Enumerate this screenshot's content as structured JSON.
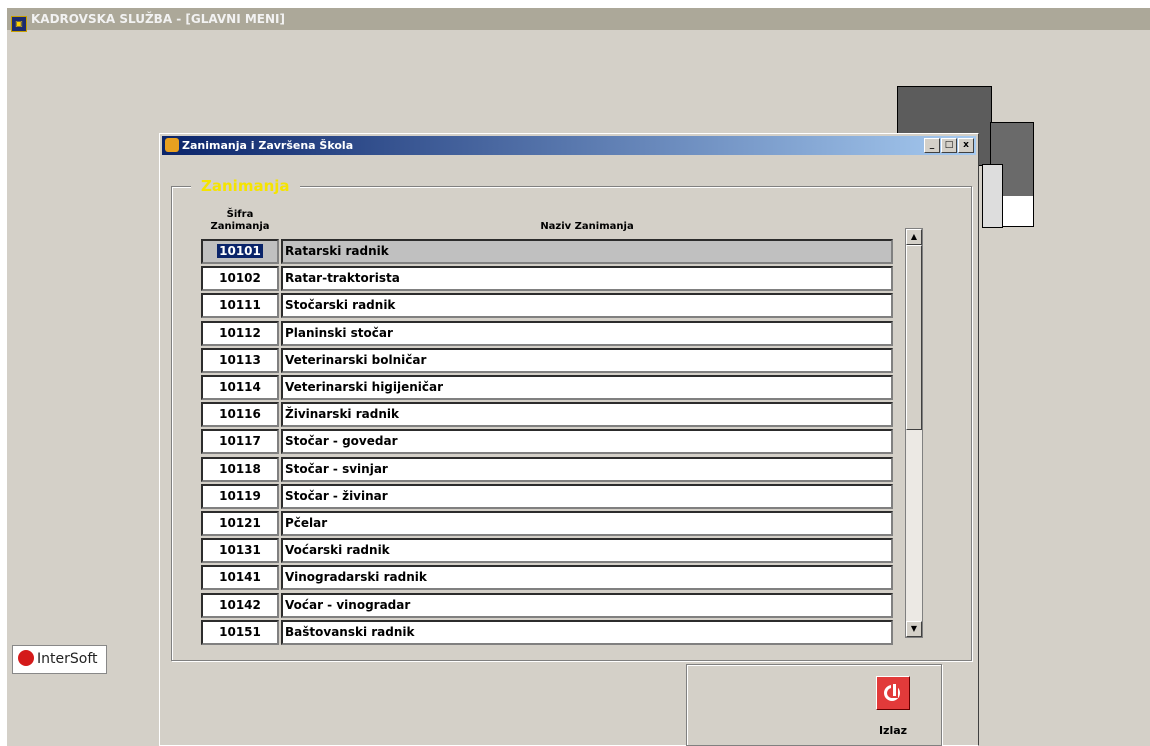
{
  "app": {
    "title": "KADROVSKA SLUŽBA - [GLAVNI MENI]"
  },
  "logo": {
    "text": "InterSoft"
  },
  "dialog": {
    "title": "Zanimanja i Završena Škola",
    "window_buttons": {
      "minimize": "_",
      "maximize": "□",
      "close": "x"
    },
    "group_title": "Zanimanja",
    "columns": {
      "code_line1": "Šifra",
      "code_line2": "Zanimanja",
      "name": "Naziv Zanimanja"
    },
    "rows": [
      {
        "code": "10101",
        "name": "Ratarski radnik",
        "selected": true
      },
      {
        "code": "10102",
        "name": "Ratar-traktorista"
      },
      {
        "code": "10111",
        "name": "Stočarski radnik"
      },
      {
        "code": "10112",
        "name": "Planinski stočar"
      },
      {
        "code": "10113",
        "name": "Veterinarski bolničar"
      },
      {
        "code": "10114",
        "name": "Veterinarski higijeničar"
      },
      {
        "code": "10116",
        "name": "Živinarski radnik"
      },
      {
        "code": "10117",
        "name": "Stočar - govedar"
      },
      {
        "code": "10118",
        "name": "Stočar - svinjar"
      },
      {
        "code": "10119",
        "name": "Stočar - živinar"
      },
      {
        "code": "10121",
        "name": "Pčelar"
      },
      {
        "code": "10131",
        "name": "Voćarski radnik"
      },
      {
        "code": "10141",
        "name": "Vinogradarski radnik"
      },
      {
        "code": "10142",
        "name": "Voćar - vinogradar"
      },
      {
        "code": "10151",
        "name": "Baštovanski radnik"
      }
    ],
    "exit_label": "Izlaz"
  },
  "colors": {
    "group_title": "#f5e400",
    "title_bar": "#0a246a",
    "exit_button": "#e23a3a"
  }
}
